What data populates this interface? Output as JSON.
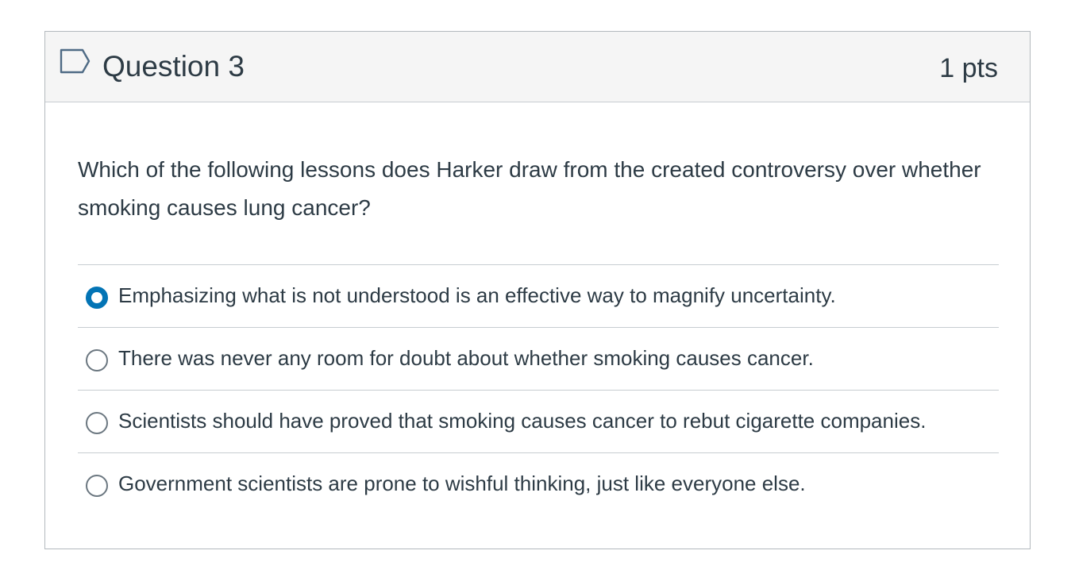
{
  "question": {
    "title": "Question 3",
    "points": "1 pts",
    "flag_icon": "flag-outline-icon",
    "text": "Which of the following lessons does Harker draw from the created controversy over whether smoking causes lung cancer?",
    "answers": [
      {
        "label": "Emphasizing what is not understood is an effective way to magnify uncertainty.",
        "selected": true
      },
      {
        "label": "There was never any room for doubt about whether smoking causes cancer.",
        "selected": false
      },
      {
        "label": "Scientists should have proved that smoking causes cancer to rebut cigarette companies.",
        "selected": false
      },
      {
        "label": "Government scientists are prone to wishful thinking, just like everyone else.",
        "selected": false
      }
    ]
  },
  "colors": {
    "accent": "#0374b5",
    "text": "#2d3b45",
    "header_bg": "#f5f5f5",
    "border": "#b3b9be"
  }
}
